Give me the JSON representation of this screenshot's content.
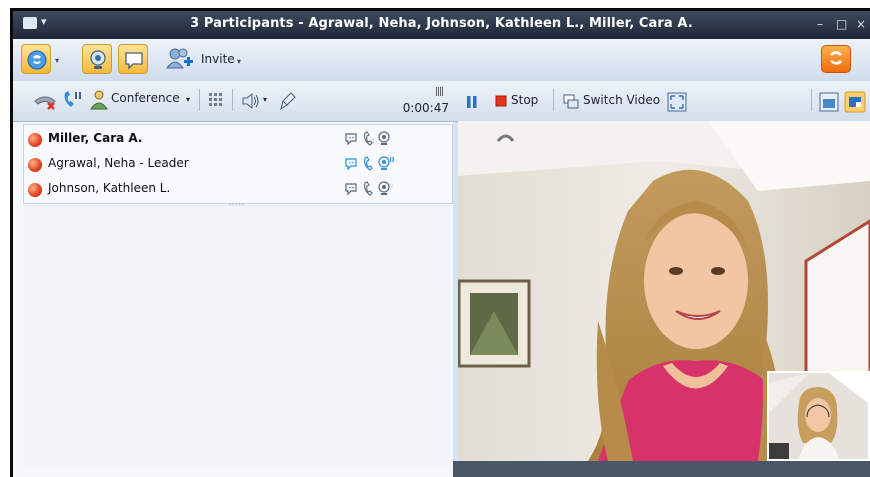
{
  "window": {
    "title": "3 Participants - Agrawal, Neha, Johnson, Kathleen L., Miller, Cara A.",
    "menu_glyph": "▾",
    "minimize": "–",
    "maximize": "□",
    "close": "×"
  },
  "toolbar": {
    "invite_label": "Invite",
    "dropdown_arrow": "▾"
  },
  "call_toolbar": {
    "conference_label": "Conference",
    "dropdown_arrow": "▾",
    "timer": "0:00:47",
    "signal": "||||"
  },
  "participants": [
    {
      "name": "Miller, Cara A.",
      "bold": true
    },
    {
      "name": "Agrawal, Neha - Leader",
      "bold": false
    },
    {
      "name": "Johnson, Kathleen L.",
      "bold": false
    }
  ],
  "video_toolbar": {
    "stop_label": "Stop",
    "switch_video_label": "Switch Video"
  },
  "colors": {
    "accent_orange": "#f26b0c",
    "status_red": "#e2401a",
    "icon_blue": "#2f8fe0"
  }
}
